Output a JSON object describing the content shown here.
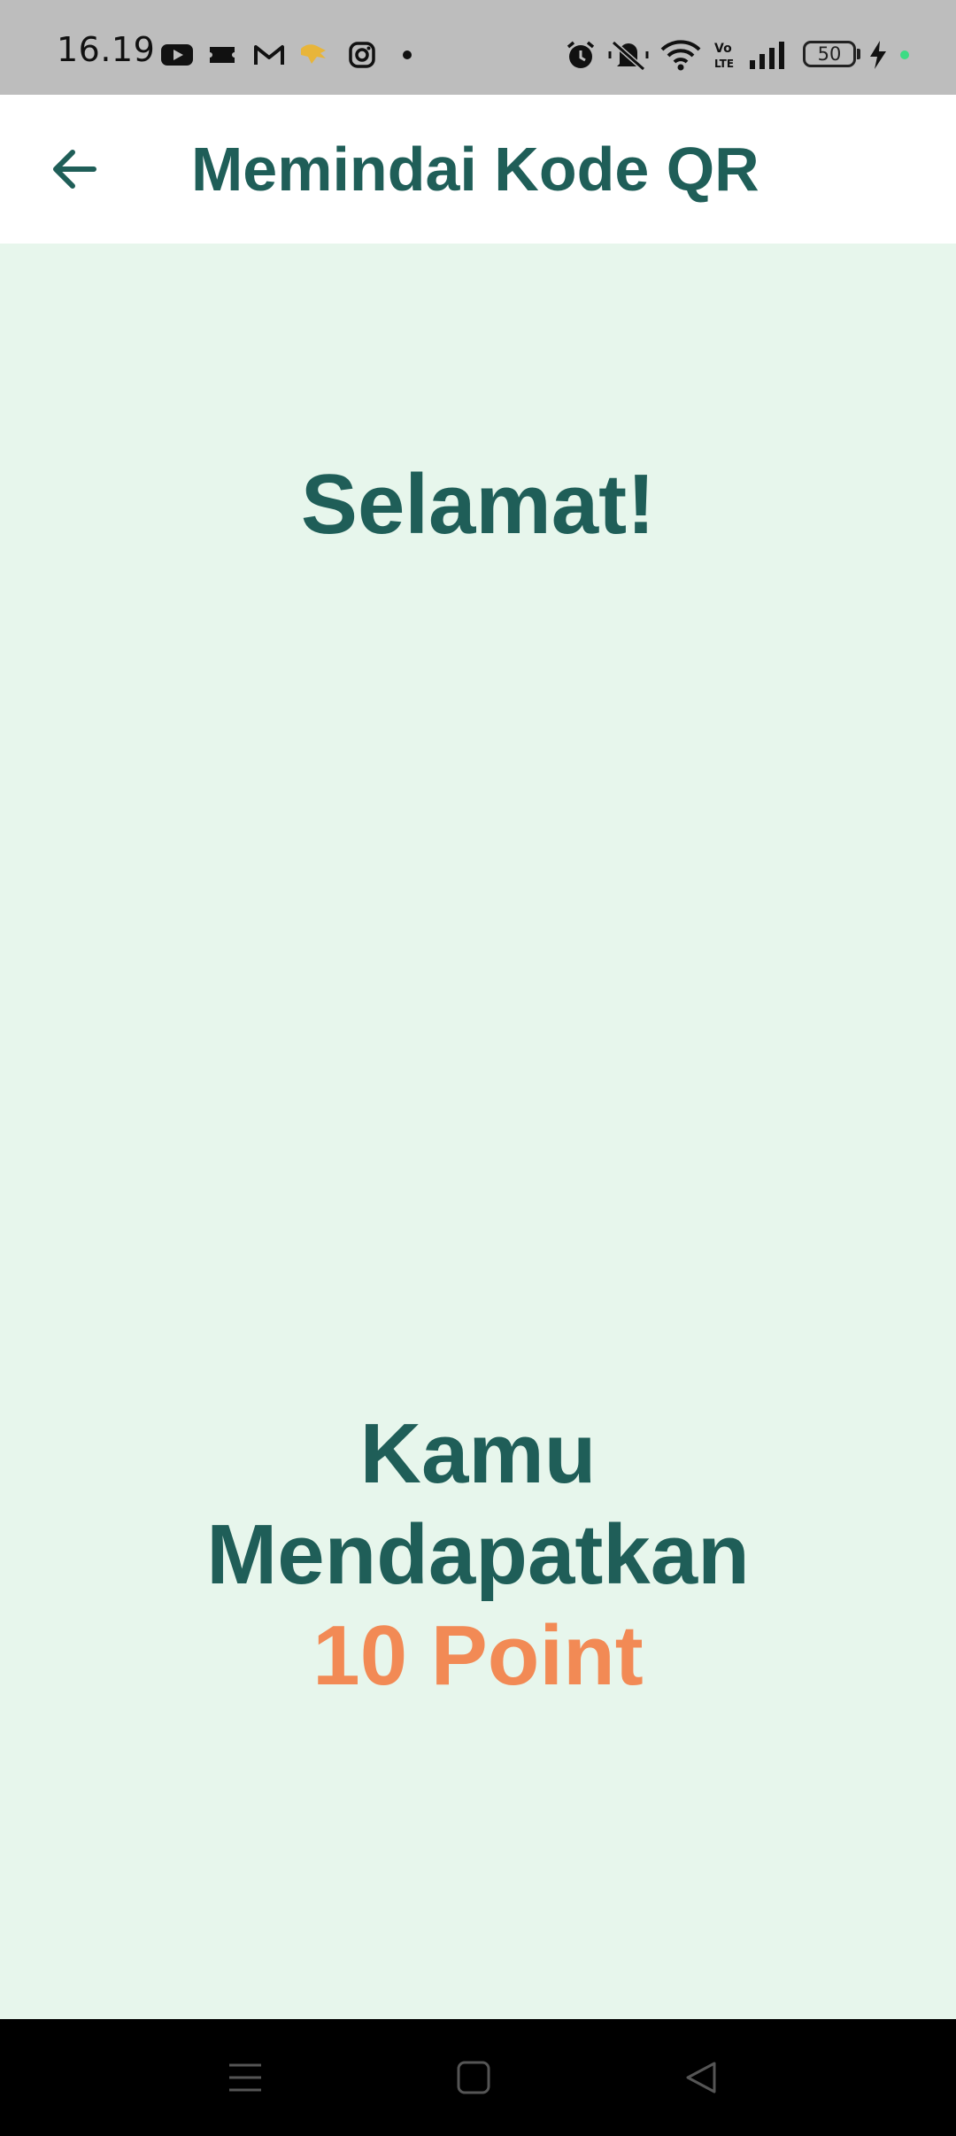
{
  "status_bar": {
    "time": "16.19",
    "battery_level": "50",
    "icons": [
      "youtube-icon",
      "ticket-icon",
      "gmail-icon",
      "lion-air-icon",
      "instagram-icon",
      "dot-icon",
      "alarm-icon",
      "mute-icon",
      "wifi-icon",
      "volte-icon",
      "signal-icon",
      "battery-icon",
      "charging-icon",
      "green-dot-icon"
    ]
  },
  "app_bar": {
    "title": "Memindai Kode QR",
    "back_icon": "arrow-left-icon"
  },
  "main": {
    "congrats_text": "Selamat!",
    "reward_line1": "Kamu",
    "reward_line2": "Mendapatkan",
    "reward_points": "10 Point"
  },
  "nav_bar": {
    "icons": [
      "menu-icon",
      "home-icon",
      "back-triangle-icon"
    ]
  },
  "colors": {
    "primary": "#1f5e58",
    "accent": "#f28a55",
    "background": "#e7f6ec",
    "status_bar": "#bdbdbd"
  }
}
